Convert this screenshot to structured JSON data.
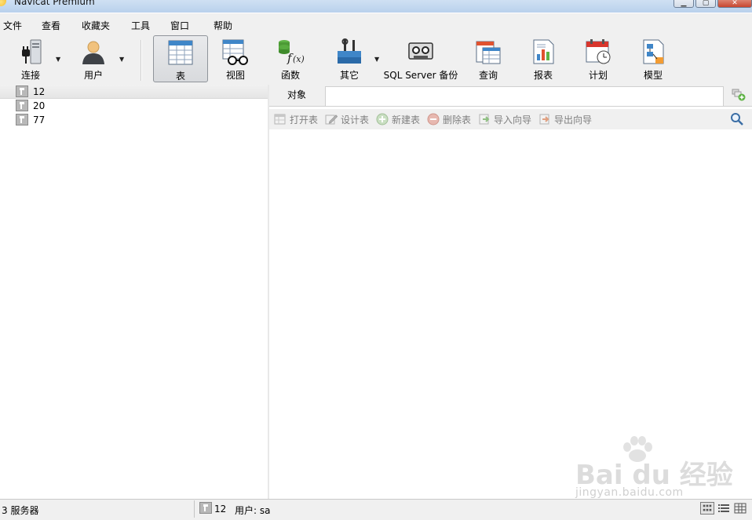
{
  "window": {
    "title": "Navicat Premium"
  },
  "menu": [
    "文件",
    "查看",
    "收藏夹",
    "工具",
    "窗口",
    "帮助"
  ],
  "toolbar": {
    "connect": "连接",
    "user": "用户",
    "table": "表",
    "view": "视图",
    "function": "函数",
    "other": "其它",
    "backup": "SQL Server 备份",
    "query": "查询",
    "report": "报表",
    "schedule": "计划",
    "model": "模型"
  },
  "connections": [
    "12",
    "20",
    "77"
  ],
  "tab": {
    "objects": "对象"
  },
  "object_toolbar": {
    "open": "打开表",
    "design": "设计表",
    "new": "新建表",
    "delete": "删除表",
    "import": "导入向导",
    "export": "导出向导"
  },
  "watermark": {
    "brand": "Bai du 经验",
    "url": "jingyan.baidu.com"
  },
  "status": {
    "servers": "3 服务器",
    "connection": "12",
    "user": "用户: sa"
  }
}
